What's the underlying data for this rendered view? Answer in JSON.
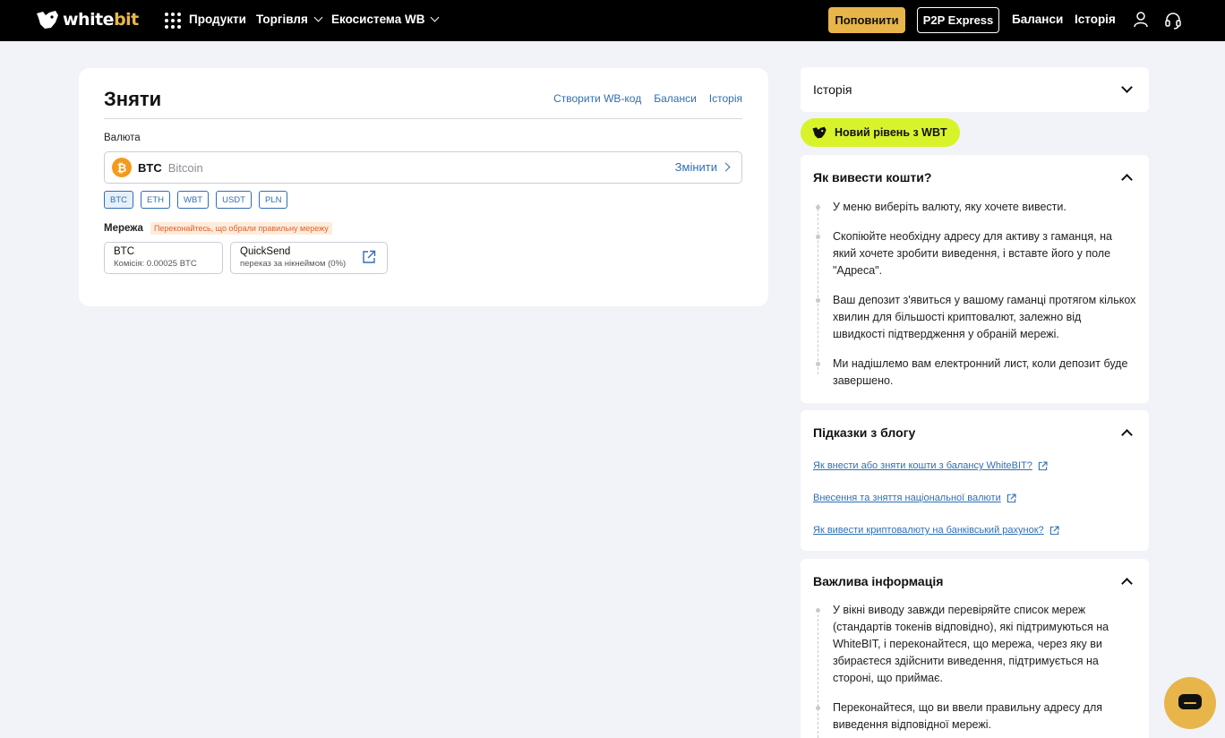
{
  "header": {
    "logo": {
      "white": "white",
      "bit": "bit"
    },
    "nav": [
      {
        "label": "Продукти"
      },
      {
        "label": "Торгівля"
      },
      {
        "label": "Екосистема WB"
      }
    ],
    "deposit_label": "Поповнити",
    "p2p_label": "P2P Express",
    "balances_label": "Баланси",
    "history_label": "Історія"
  },
  "main": {
    "title": "Зняти",
    "links": {
      "create_code": "Створити WB-код",
      "balances": "Баланси",
      "history": "Історія"
    },
    "currency_label": "Валюта",
    "currency": {
      "icon_glyph": "₿",
      "code": "BTC",
      "name": "Bitcoin",
      "change_label": "Змінити"
    },
    "chips": [
      "BTC",
      "ETH",
      "WBT",
      "USDT",
      "PLN"
    ],
    "network_label": "Мережа",
    "network_warning": "Переконайтесь, що обрали правильну мережу",
    "networks": [
      {
        "title": "BTC",
        "subtitle": "Комісія: 0.00025 BTC"
      },
      {
        "title": "QuickSend",
        "subtitle": "переказ за нікнеймом (0%)"
      }
    ]
  },
  "side": {
    "history_title": "Історія",
    "wbt_badge": "Новий рівень з WBT",
    "how_title": "Як вивести кошти?",
    "how_steps": [
      "У меню виберіть валюту, яку хочете вивести.",
      "Скопіюйте необхідну адресу для активу з гаманця, на який хочете зробити виведення, і вставте його у поле \"Адреса\".",
      "Ваш депозит з'явиться у вашому гаманці протягом кількох хвилин для більшості криптовалют, залежно від швидкості підтвердження у обраній мережі.",
      "Ми надішлемо вам електронний лист, коли депозит буде завершено."
    ],
    "blog_title": "Підказки з блогу",
    "blog_links": [
      "Як внести або зняти кошти з балансу WhiteBIT?",
      "Внесення та зняття національної валюти",
      "Як вивести криптовалюту на банківський рахунок?"
    ],
    "important_title": "Важлива інформація",
    "important_steps": [
      "У вікні виводу завжди перевіряйте список мереж (стандартів токенів відповідно), які підтримуються на WhiteBIT, і переконайтеся, що мережа, через яку ви збираєтеся здійснити виведення, підтримується на стороні, що приймає.",
      "Переконайтеся, що ви ввели правильну адресу для виведення відповідної мережі."
    ]
  },
  "colors": {
    "accent": "#e7b54a",
    "link": "#2f6fb3",
    "wbt": "#d9f32a",
    "btc": "#f39a1e",
    "warning": "#e0622a"
  }
}
